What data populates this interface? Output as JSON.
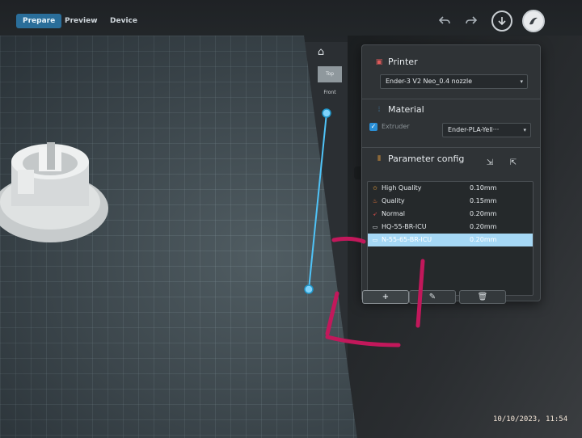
{
  "tabs": [
    {
      "label": "Prepare",
      "active": true
    },
    {
      "label": "Preview",
      "active": false
    },
    {
      "label": "Device",
      "active": false
    }
  ],
  "icons": {
    "undo": "undo-icon",
    "redo": "redo-icon",
    "download": "download-icon",
    "avatar": "avatar-icon",
    "home": "home-icon"
  },
  "view": {
    "top_label": "Top",
    "front_label": "Front"
  },
  "printer": {
    "title": "Printer",
    "selected": "Ender-3 V2 Neo_0.4 nozzle"
  },
  "material": {
    "title": "Material",
    "extruder_label": "Extruder",
    "extruder_checked": true,
    "selected": "Ender-PLA-Yell···"
  },
  "parameter_config": {
    "title": "Parameter config",
    "rows": [
      {
        "name": "High Quality",
        "value": "0.10mm",
        "icon": "star-icon",
        "selected": false
      },
      {
        "name": "Quality",
        "value": "0.15mm",
        "icon": "flame-icon",
        "selected": false
      },
      {
        "name": "Normal",
        "value": "0.20mm",
        "icon": "rocket-icon",
        "selected": false
      },
      {
        "name": "HQ-55-BR-ICU",
        "value": "0.20mm",
        "icon": "file-icon",
        "selected": false
      },
      {
        "name": "N-55-65-BR-ICU",
        "value": "0.20mm",
        "icon": "file-icon",
        "selected": true
      }
    ],
    "buttons": {
      "add": "+",
      "edit": "✎",
      "delete": "🗑"
    }
  },
  "colors": {
    "accent": "#2a6e9a",
    "selection": "#a6d8f5",
    "slider_line": "#4fc3f7",
    "annotation": "#c2185b"
  },
  "timestamp": "10/10/2023, 11:54"
}
